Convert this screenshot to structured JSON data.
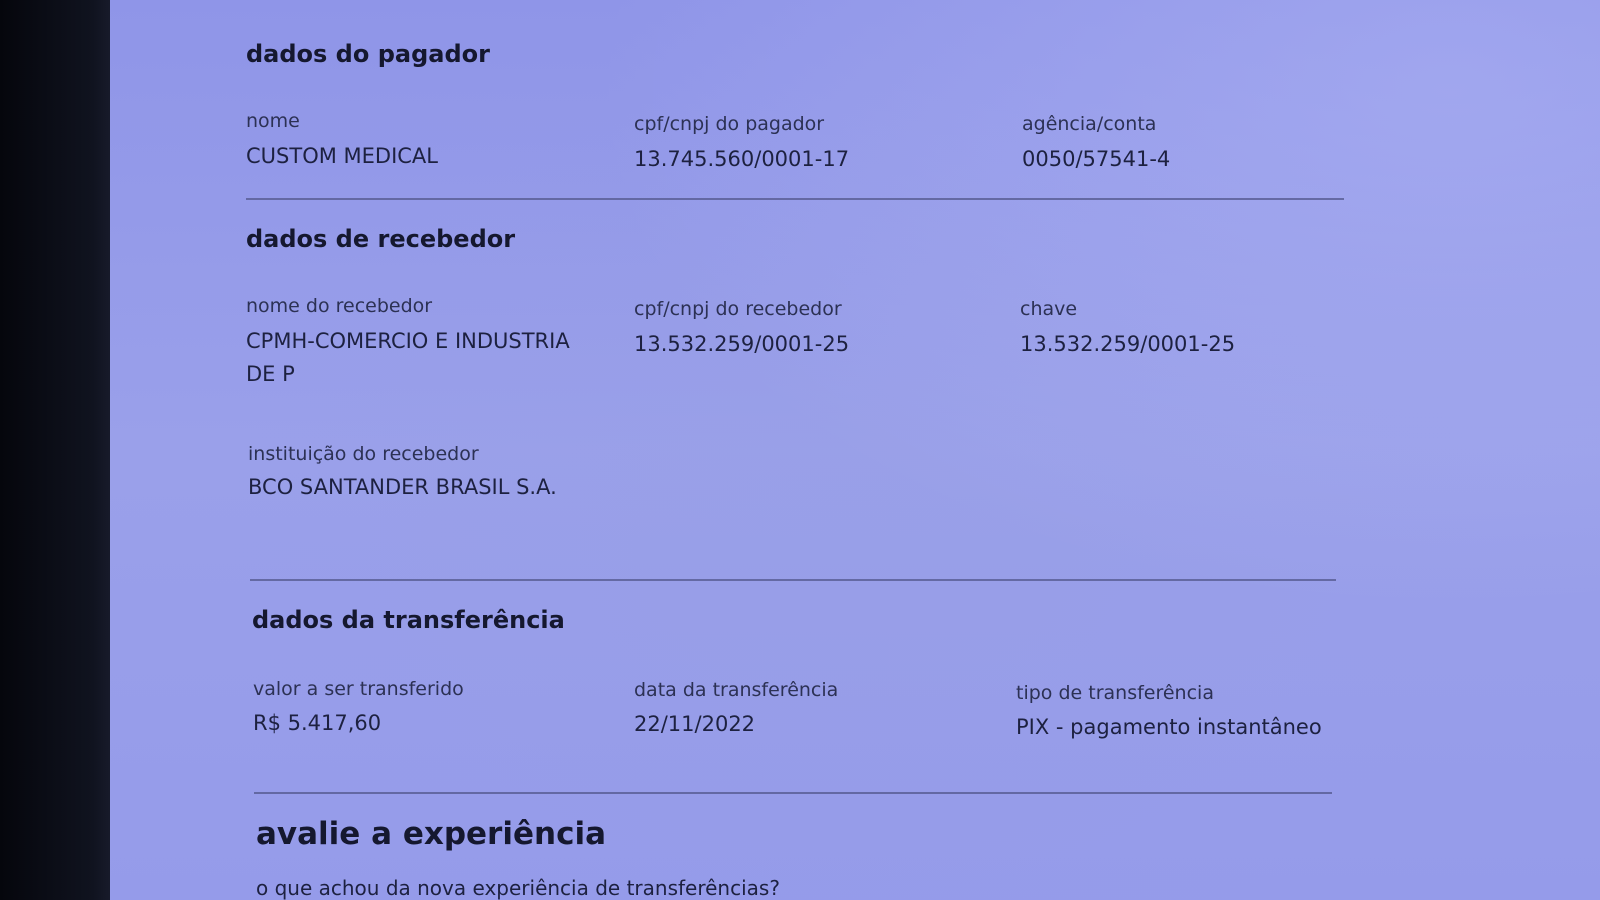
{
  "payer": {
    "section_title": "dados do pagador",
    "name_label": "nome",
    "name_value": "CUSTOM MEDICAL",
    "doc_label": "cpf/cnpj do pagador",
    "doc_value": "13.745.560/0001-17",
    "account_label": "agência/conta",
    "account_value": "0050/57541-4"
  },
  "receiver": {
    "section_title": "dados de recebedor",
    "name_label": "nome do recebedor",
    "name_value": "CPMH-COMERCIO E INDUSTRIA DE P",
    "doc_label": "cpf/cnpj do recebedor",
    "doc_value": "13.532.259/0001-25",
    "key_label": "chave",
    "key_value": "13.532.259/0001-25",
    "institution_label": "instituição do recebedor",
    "institution_value": "BCO SANTANDER BRASIL S.A."
  },
  "transfer": {
    "section_title": "dados da transferência",
    "amount_label": "valor a ser transferido",
    "amount_value": "R$ 5.417,60",
    "date_label": "data da transferência",
    "date_value": "22/11/2022",
    "type_label": "tipo de transferência",
    "type_value": "PIX - pagamento instantâneo"
  },
  "feedback": {
    "title": "avalie a experiência",
    "question": "o que achou da nova experiência de transferências?"
  }
}
